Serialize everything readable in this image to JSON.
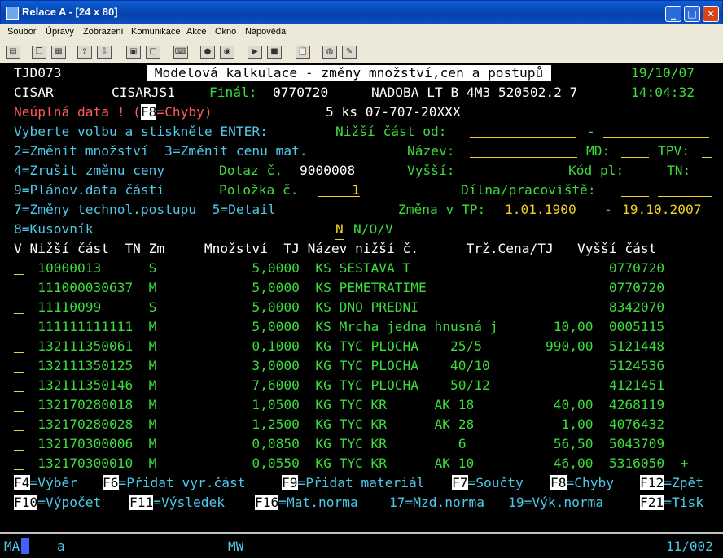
{
  "window": {
    "title": "Relace A - [24 x 80]"
  },
  "menu": [
    "Soubor",
    "Úpravy",
    "Zobrazení",
    "Komunikace",
    "Akce",
    "Okno",
    "Nápověda"
  ],
  "screen": {
    "r1": {
      "prog": "TJD073",
      "title": " Modelová kalkulace - změny množství,cen a postupů ",
      "date": "19/10/07"
    },
    "r2": {
      "user": "CISAR",
      "ws": "CISARJS1",
      "final_label": "Finál:",
      "final": "0770720",
      "product": "NADOBA LT B 4M3 520502.2 7",
      "time": "14:04:32"
    },
    "r3": {
      "warn1": "Neúplná data ! (",
      "f8": "F8",
      "warn2": "=Chyby)",
      "qty": "5 ks 07-707-20XXX"
    },
    "r4": {
      "a": "Vyberte volbu a stiskněte ENTER:",
      "b": "Nižší část od:",
      "dash": "-"
    },
    "r5": {
      "a": "2=Změnit množství  3=Změnit cenu mat.",
      "b": "Název:",
      "md": "MD:",
      "tpv": "TPV:"
    },
    "r6": {
      "a": "4=Zrušit změnu ceny",
      "b": "Dotaz č.",
      "v": "9000008",
      "c": "Vyšší:",
      "kod": "Kód pl:",
      "tn": "TN:"
    },
    "r7": {
      "a": "9=Plánov.data části",
      "b": "Položka č.",
      "v": "1",
      "c": "Dílna/pracoviště:"
    },
    "r8": {
      "a": "7=Změny technol.postupu  5=Detail",
      "b": "Změna v TP:",
      "d1": "1.01.1900",
      "dash": "-",
      "d2": "19.10.2007"
    },
    "r9": {
      "a": "8=Kusovník",
      "n": "N",
      "nov": "N/O/V"
    },
    "header": "V Nižší část  TN Zm     Množství  TJ Název nižší č.      Trž.Cena/TJ   Vyšší část",
    "rows": [
      "   10000013      S            5,0000  KS SESTAVA T                         0770720",
      "   111000030637  M            5,0000  KS PEMETRATIME                       0770720",
      "   11110099      S            5,0000  KS DNO PREDNI                        8342070",
      "   111111111111  M            5,0000  KS Mrcha jedna hnusná j       10,00  0005115",
      "   132111350061  M            0,1000  KG TYC PLOCHA    25/5        990,00  5121448",
      "   132111350125  M            3,0000  KG TYC PLOCHA    40/10               5124536",
      "   132111350146  M            7,6000  KG TYC PLOCHA    50/12               4121451",
      "   132170280018  M            1,0500  KG TYC KR      AK 18          40,00  4268119",
      "   132170280028  M            1,2500  KG TYC KR      AK 28           1,00  4076432",
      "   132170300006  M            0,0850  KG TYC KR         6           56,50  5043709",
      "   132170300010  M            0,0550  KG TYC KR      AK 10          46,00  5316050  +"
    ],
    "fkeys1": [
      {
        "k": "F4",
        "t": "=Výběr"
      },
      {
        "k": "F6",
        "t": "=Přidat vyr.část"
      },
      {
        "k": "F9",
        "t": "=Přidat materiál"
      },
      {
        "k": "F7",
        "t": "=Součty"
      },
      {
        "k": "F8",
        "t": "=Chyby"
      },
      {
        "k": "F12",
        "t": "=Zpět"
      }
    ],
    "fkeys2": [
      {
        "k": "F10",
        "t": "=Výpočet"
      },
      {
        "k": "F11",
        "t": "=Výsledek"
      },
      {
        "k": "F16",
        "t": "=Mat.norma"
      },
      {
        "k": "",
        "t": "17=Mzd.norma   19=Výk.norma"
      },
      {
        "k": "F21",
        "t": "=Tisk"
      }
    ]
  },
  "status": {
    "ma": "MA",
    "a": "a",
    "mw": "MW",
    "pos": "11/002"
  }
}
